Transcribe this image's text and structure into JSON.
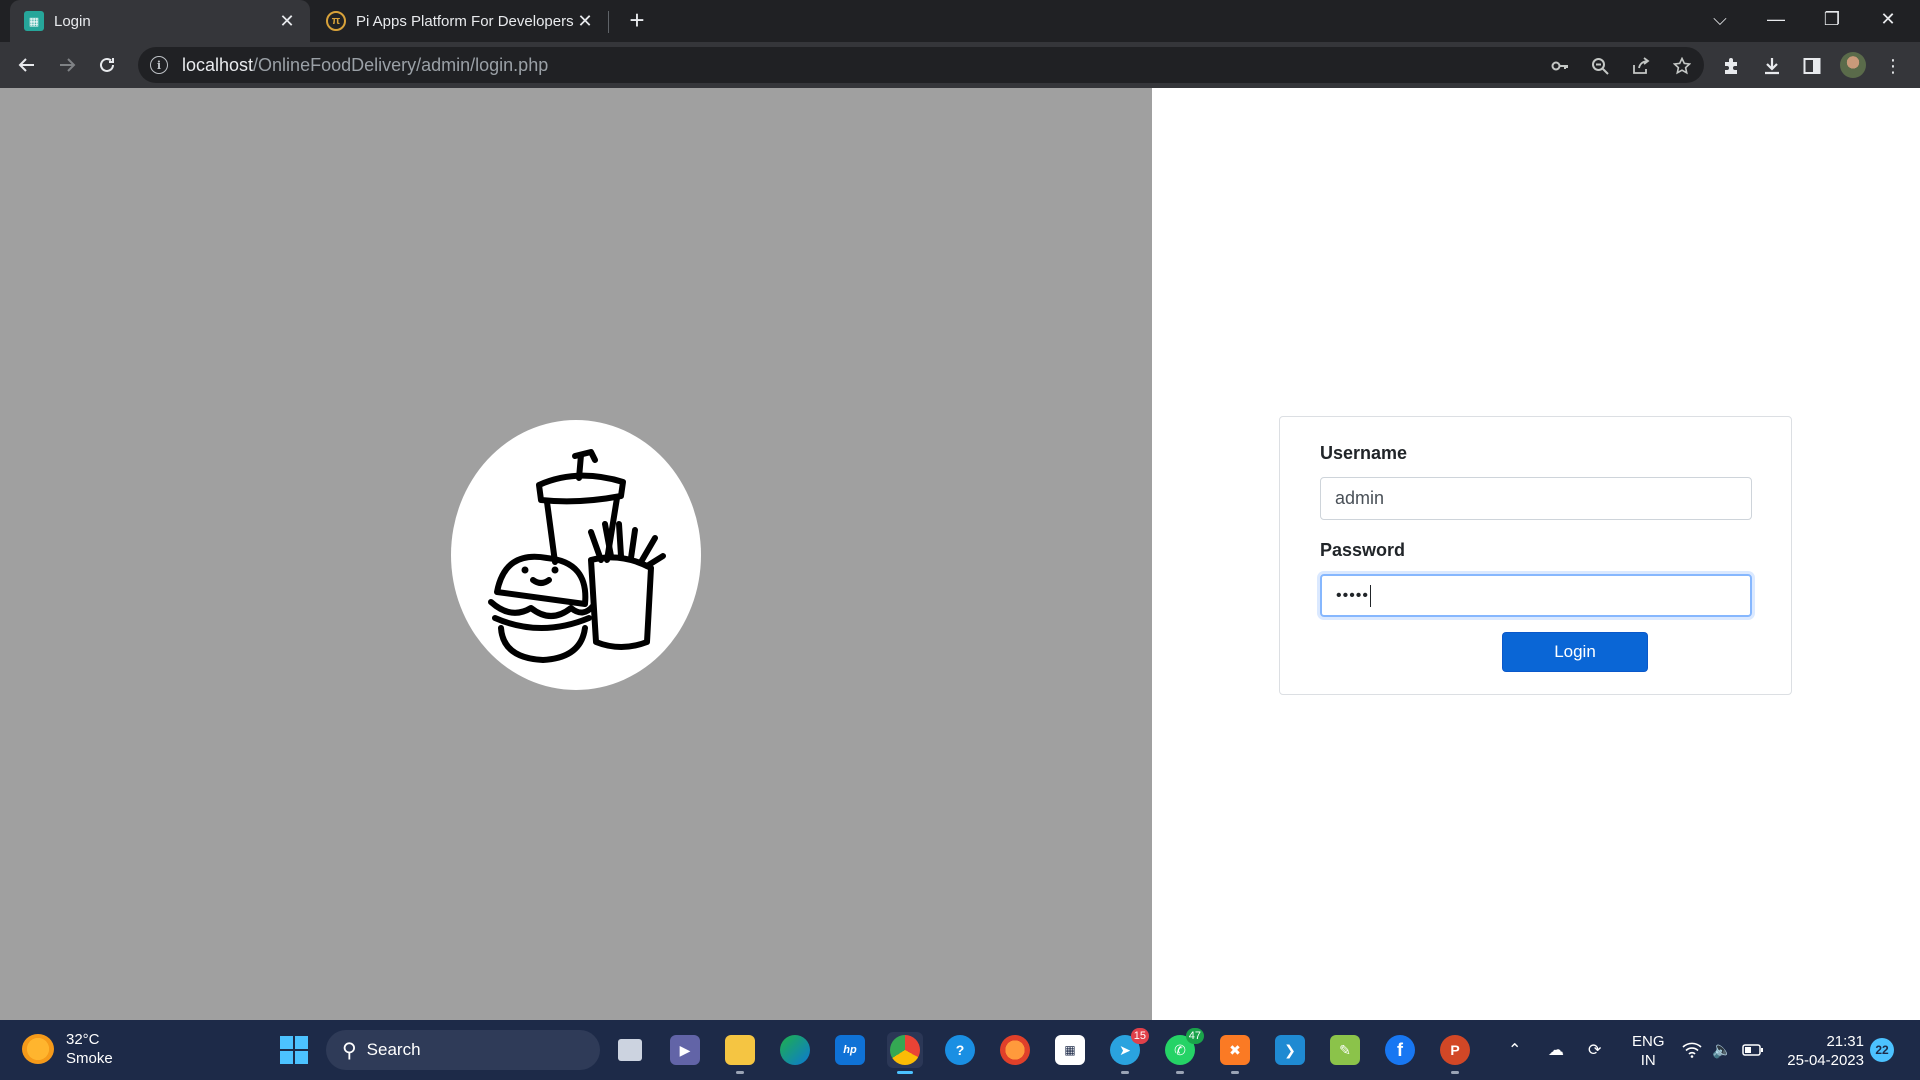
{
  "browser": {
    "tabs": [
      {
        "title": "Login",
        "active": true
      },
      {
        "title": "Pi Apps Platform For Developers",
        "active": false
      }
    ],
    "url_host": "localhost",
    "url_path": "/OnlineFoodDelivery/admin/login.php",
    "icons": {
      "back": "arrow-left-icon",
      "forward": "arrow-right-icon",
      "reload": "reload-icon",
      "site_info": "info-icon",
      "password_key": "key-icon",
      "zoom": "zoom-out-icon",
      "share": "share-icon",
      "bookmark": "star-icon",
      "extensions": "puzzle-icon",
      "downloads": "download-icon",
      "side_panel": "side-panel-icon",
      "menu": "kebab-menu-icon"
    }
  },
  "login_form": {
    "username_label": "Username",
    "username_value": "admin",
    "password_label": "Password",
    "password_masked": "•••••",
    "submit_label": "Login",
    "accent_color": "#0a66d6"
  },
  "logo": {
    "depicts": "food-logo-burger-fries-drink"
  },
  "taskbar": {
    "weather_temp": "32°C",
    "weather_desc": "Smoke",
    "search_label": "Search",
    "telegram_badge": "15",
    "whatsapp_badge": "47",
    "lang_line1": "ENG",
    "lang_line2": "IN",
    "time": "21:31",
    "date": "25-04-2023",
    "notifications": "22"
  }
}
